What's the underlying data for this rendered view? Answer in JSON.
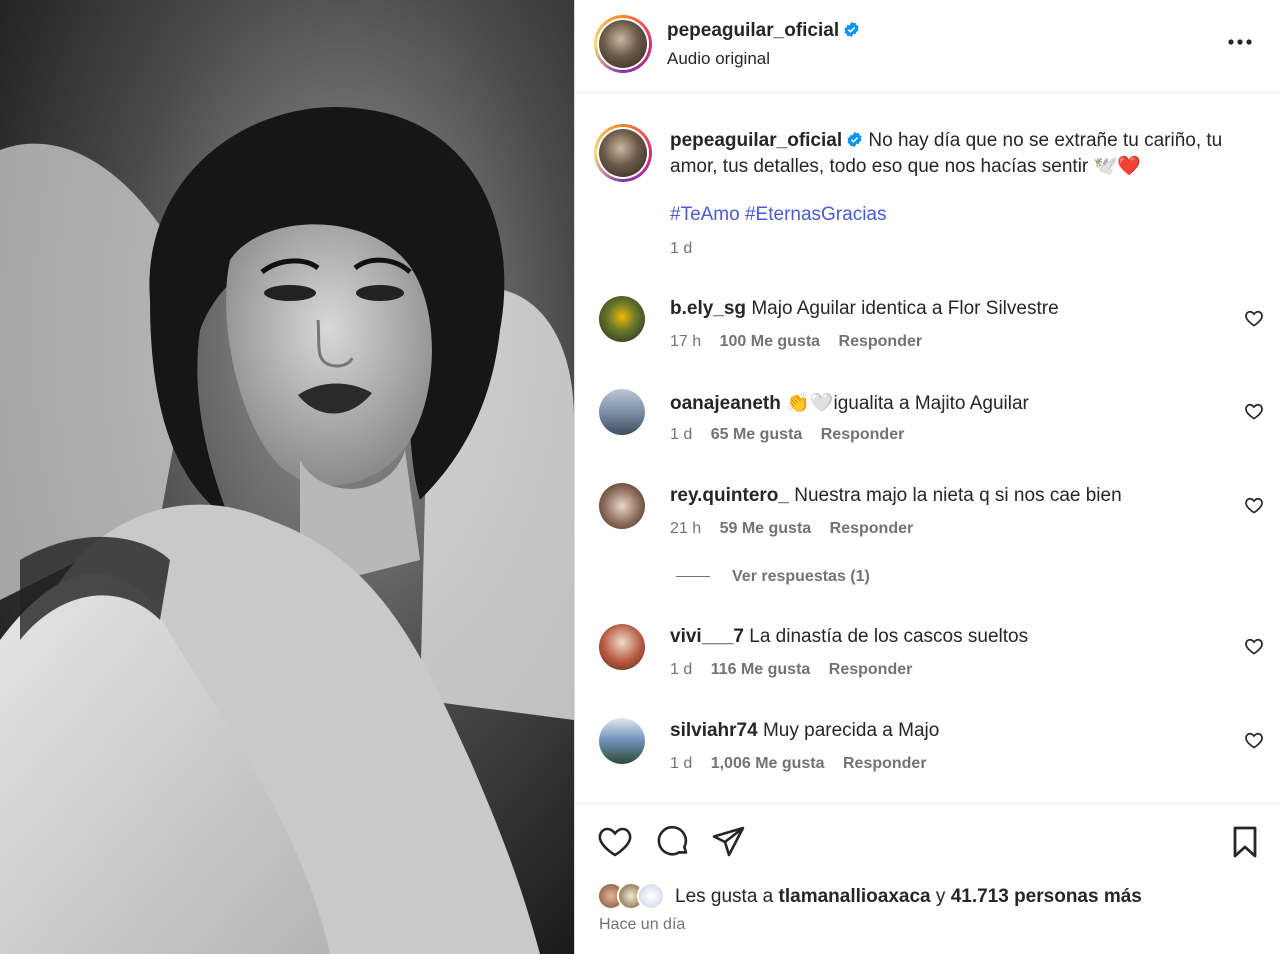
{
  "post": {
    "username": "pepeaguilar_oficial",
    "audio": "Audio original",
    "caption_text": "No hay día que no se extrañe tu cariño, tu amor, tus detalles, todo eso que nos hacías sentir",
    "caption_emoji": "🕊️❤️",
    "hashtags": [
      "#TeAmo",
      "#EternasGracias"
    ],
    "caption_time": "1 d"
  },
  "comments": [
    {
      "user": "b.ely_sg",
      "text": "Majo Aguilar identica a Flor Silvestre",
      "time": "17 h",
      "likes": "100 Me gusta",
      "reply": "Responder",
      "avatar_color": "#f2b705"
    },
    {
      "user": "oanajeaneth",
      "text": "igualita a Majito Aguilar",
      "emoji": "👏🤍",
      "time": "1 d",
      "likes": "65 Me gusta",
      "reply": "Responder",
      "avatar_color": "#7d8fa6"
    },
    {
      "user": "rey.quintero_",
      "text": "Nuestra majo la nieta q si nos cae bien",
      "time": "21 h",
      "likes": "59 Me gusta",
      "reply": "Responder",
      "avatar_color": "#8b6a58"
    },
    {
      "user": "vivi___7",
      "text": "La dinastía de los cascos sueltos",
      "time": "1 d",
      "likes": "116 Me gusta",
      "reply": "Responder",
      "avatar_color": "#b5563f"
    },
    {
      "user": "silviahr74",
      "text": "Muy parecida a Majo",
      "time": "1 d",
      "likes": "1,006 Me gusta",
      "reply": "Responder",
      "avatar_color": "#6d8fb5"
    }
  ],
  "replies_label": "Ver respuestas (1)",
  "footer": {
    "likes_prefix": "Les gusta a",
    "likes_user": "tlamanallioaxaca",
    "likes_connector": "y",
    "likes_count": "41.713 personas más",
    "posted": "Hace un día"
  },
  "icons": {
    "more": "more-options-icon",
    "verified": "verified-badge-icon",
    "heart": "heart-icon",
    "comment": "comment-icon",
    "share": "share-icon",
    "save": "bookmark-icon"
  },
  "colors": {
    "verified": "#0095f6",
    "hashtag": "#4a5bd4",
    "muted": "#737373",
    "text": "#262626"
  }
}
